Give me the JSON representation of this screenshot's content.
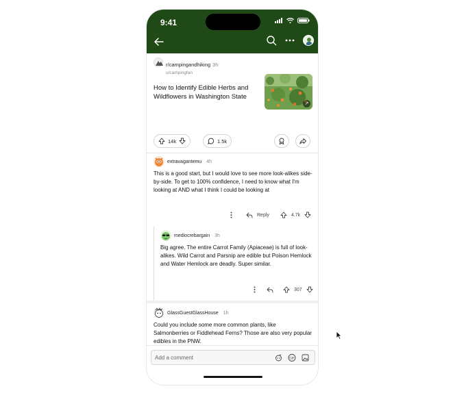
{
  "status_bar": {
    "time": "9:41"
  },
  "post": {
    "subreddit": "r/campingandhiking",
    "age": "3h",
    "author": "u/campingfan",
    "title": "How to Identify Edible Herbs and Wildflowers in Washington State",
    "upvotes": "14k",
    "comments": "1.5k"
  },
  "comments": [
    {
      "user": "extravagantemu",
      "age": "4h",
      "body": "This is a good start, but I would love to see more look-alikes side-by-side. To get to 100% confidence, I need to know what I'm looking at AND what I think I could be looking at",
      "reply_label": "Reply",
      "votes": "4.7k"
    },
    {
      "user": "mediocrebargain",
      "age": "3h",
      "body": "Big agree. The entire Carrot Family (Apiaceae) is full of look-alikes. Wild Carrot and Parsnip are edible but Poison Hemlock and Water Hemlock are deadly. Super similar.",
      "votes": "307"
    },
    {
      "user": "GlassGuestGlassHouse",
      "age": "1h",
      "body": "Could you include some more common plants, like Salmonberries or Fiddlehead Ferns? Those are also very popular edibles in the PNW."
    }
  ],
  "composer": {
    "placeholder": "Add a comment"
  },
  "colors": {
    "header_bg": "#1f4a17",
    "text": "#111111",
    "muted": "#888888"
  },
  "icons": [
    "back-arrow-icon",
    "search-icon",
    "more-icon",
    "profile-avatar-icon",
    "upvote-icon",
    "downvote-icon",
    "comment-icon",
    "award-icon",
    "share-icon",
    "reply-icon",
    "link-icon",
    "snoo-icon",
    "gif-icon",
    "image-icon",
    "cursor-icon"
  ]
}
